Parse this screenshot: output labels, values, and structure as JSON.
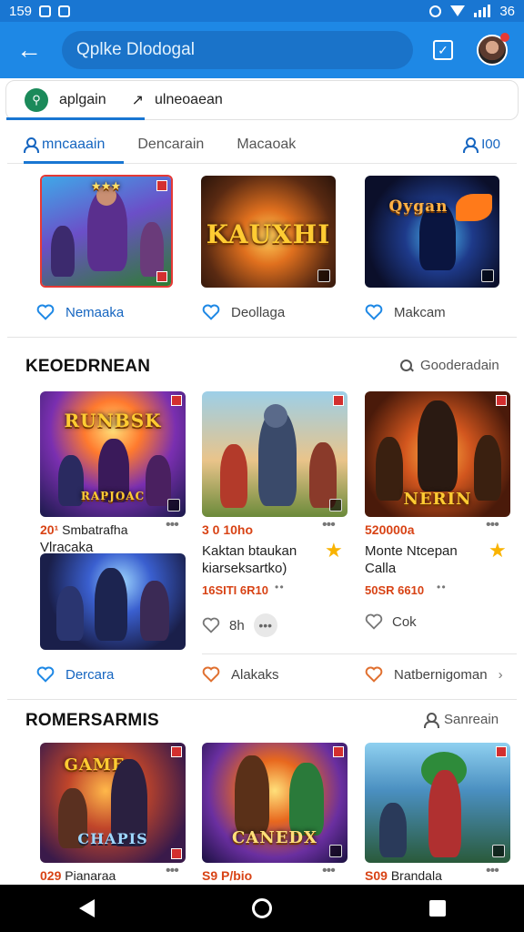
{
  "status_bar": {
    "time": "159",
    "battery": "36"
  },
  "app_bar": {
    "search_placeholder": "Qplke Dlodogal"
  },
  "chips": {
    "primary": "aplgain",
    "secondary": "ulneoaean"
  },
  "tabs": {
    "items": [
      "mncaaain",
      "Dencarain",
      "Macaoak"
    ],
    "right": "I00"
  },
  "top_row": [
    {
      "label": "Nemaaka",
      "title": "",
      "style": "blue"
    },
    {
      "label": "Deollaga",
      "title": "KAUXHI",
      "style": "fire"
    },
    {
      "label": "Makcam",
      "title": "Qygan",
      "style": "night"
    }
  ],
  "section1": {
    "title": "KEOEDRNEAN",
    "link": "Gooderadain",
    "games": [
      {
        "art_title": "RUNBSK",
        "art_sub": "RAPJOAC",
        "meta_num": "20¹",
        "meta_name": "Smbatrafha",
        "title": "Vlracaka",
        "price": "",
        "tag": ""
      },
      {
        "art_title": "",
        "art_sub": "",
        "meta_num": "3 0",
        "meta_name": "10ho",
        "title": "Kaktan btaukan kiarseksartko)",
        "price": "16SITI 6R10",
        "rating": "8h"
      },
      {
        "art_title": "NERIN",
        "art_sub": "",
        "meta_num": "520",
        "meta_name": "000a",
        "title": "Monte Ntcepan Calla",
        "price": "50SR 6610",
        "rating": "Cok"
      }
    ],
    "extra_card_label": "Dercara",
    "footer_labels": [
      "Dercara",
      "Alakaks",
      "Natbernigoman"
    ]
  },
  "section2": {
    "title": "ROMERSARMIS",
    "link": "Sanreain",
    "games": [
      {
        "art_title": "GAME",
        "art_sub": "CHAPIS",
        "meta_num": "029",
        "meta_name": "Pianaraa"
      },
      {
        "art_title": "",
        "art_sub": "CANEDX",
        "meta_num": "S9",
        "meta_name": "P/bio"
      },
      {
        "art_title": "",
        "art_sub": "",
        "meta_num": "S09",
        "meta_name": "Brandala"
      }
    ]
  },
  "colors": {
    "primary": "#1e88e5",
    "accent_red": "#d84315",
    "star": "#f9b300"
  }
}
